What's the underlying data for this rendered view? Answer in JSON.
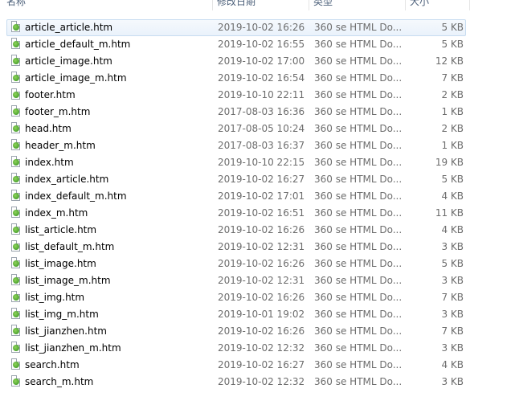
{
  "columns": {
    "name": "名称",
    "date": "修改日期",
    "type": "类型",
    "size": "大小"
  },
  "files": [
    {
      "name": "article_article.htm",
      "date": "2019-10-02 16:26",
      "type": "360 se HTML Do...",
      "size": "5 KB"
    },
    {
      "name": "article_default_m.htm",
      "date": "2019-10-02 16:55",
      "type": "360 se HTML Do...",
      "size": "5 KB"
    },
    {
      "name": "article_image.htm",
      "date": "2019-10-02 17:00",
      "type": "360 se HTML Do...",
      "size": "12 KB"
    },
    {
      "name": "article_image_m.htm",
      "date": "2019-10-02 16:54",
      "type": "360 se HTML Do...",
      "size": "7 KB"
    },
    {
      "name": "footer.htm",
      "date": "2019-10-10 22:11",
      "type": "360 se HTML Do...",
      "size": "2 KB"
    },
    {
      "name": "footer_m.htm",
      "date": "2017-08-03 16:36",
      "type": "360 se HTML Do...",
      "size": "1 KB"
    },
    {
      "name": "head.htm",
      "date": "2017-08-05 10:24",
      "type": "360 se HTML Do...",
      "size": "2 KB"
    },
    {
      "name": "header_m.htm",
      "date": "2017-08-03 16:37",
      "type": "360 se HTML Do...",
      "size": "1 KB"
    },
    {
      "name": "index.htm",
      "date": "2019-10-10 22:15",
      "type": "360 se HTML Do...",
      "size": "19 KB"
    },
    {
      "name": "index_article.htm",
      "date": "2019-10-02 16:27",
      "type": "360 se HTML Do...",
      "size": "5 KB"
    },
    {
      "name": "index_default_m.htm",
      "date": "2019-10-02 17:01",
      "type": "360 se HTML Do...",
      "size": "4 KB"
    },
    {
      "name": "index_m.htm",
      "date": "2019-10-02 16:51",
      "type": "360 se HTML Do...",
      "size": "11 KB"
    },
    {
      "name": "list_article.htm",
      "date": "2019-10-02 16:26",
      "type": "360 se HTML Do...",
      "size": "4 KB"
    },
    {
      "name": "list_default_m.htm",
      "date": "2019-10-02 12:31",
      "type": "360 se HTML Do...",
      "size": "3 KB"
    },
    {
      "name": "list_image.htm",
      "date": "2019-10-02 16:26",
      "type": "360 se HTML Do...",
      "size": "5 KB"
    },
    {
      "name": "list_image_m.htm",
      "date": "2019-10-02 12:31",
      "type": "360 se HTML Do...",
      "size": "3 KB"
    },
    {
      "name": "list_img.htm",
      "date": "2019-10-02 16:26",
      "type": "360 se HTML Do...",
      "size": "7 KB"
    },
    {
      "name": "list_img_m.htm",
      "date": "2019-10-01 19:02",
      "type": "360 se HTML Do...",
      "size": "3 KB"
    },
    {
      "name": "list_jianzhen.htm",
      "date": "2019-10-02 16:26",
      "type": "360 se HTML Do...",
      "size": "7 KB"
    },
    {
      "name": "list_jianzhen_m.htm",
      "date": "2019-10-02 12:32",
      "type": "360 se HTML Do...",
      "size": "3 KB"
    },
    {
      "name": "search.htm",
      "date": "2019-10-02 16:27",
      "type": "360 se HTML Do...",
      "size": "4 KB"
    },
    {
      "name": "search_m.htm",
      "date": "2019-10-02 12:32",
      "type": "360 se HTML Do...",
      "size": "3 KB"
    }
  ],
  "selected_index": 0,
  "icon": "html-document-icon"
}
